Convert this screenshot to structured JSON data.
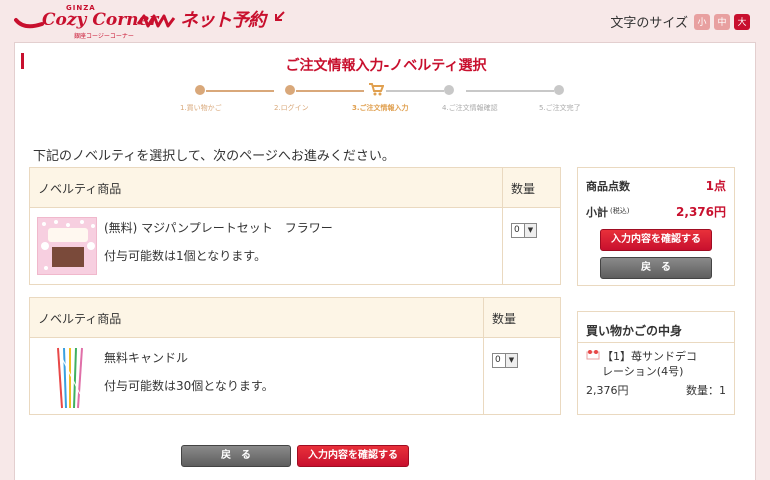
{
  "header": {
    "logo_top": "GINZA",
    "logo_main": "Cozy Corner",
    "logo_sub": "銀座コージーコーナー",
    "service_name": "ネット予約",
    "font_size_label": "文字のサイズ",
    "font_sizes": [
      "小",
      "中",
      "大"
    ]
  },
  "page": {
    "title": "ご注文情報入力-ノベルティ選択",
    "intro": "下記のノベルティを選択して、次のページへお進みください。"
  },
  "steps": [
    {
      "label": "1.買い物かご",
      "state": "done"
    },
    {
      "label": "2.ログイン",
      "state": "done"
    },
    {
      "label": "3.ご注文情報入力",
      "state": "current"
    },
    {
      "label": "4.ご注文情報確認",
      "state": "todo"
    },
    {
      "label": "5.ご注文完了",
      "state": "todo"
    }
  ],
  "novelties": [
    {
      "col_item": "ノベルティ商品",
      "col_qty": "数量",
      "name": "(無料) マジパンプレートセット　フラワー",
      "note": "付与可能数は1個となります。",
      "qty": "0",
      "thumb_icon": "marzipan-plate-image"
    },
    {
      "col_item": "ノベルティ商品",
      "col_qty": "数量",
      "name": "無料キャンドル",
      "note": "付与可能数は30個となります。",
      "qty": "0",
      "thumb_icon": "candle-image"
    }
  ],
  "summary": {
    "count_label": "商品点数",
    "count_value": "1点",
    "subtotal_label": "小計",
    "subtotal_tax": "(税込)",
    "subtotal_value": "2,376円",
    "confirm_label": "入力内容を確認する",
    "back_label": "戻　る"
  },
  "cart": {
    "title": "買い物かごの中身",
    "item_line1": "【1】苺サンドデコ",
    "item_line2": "レーション(4号)",
    "price": "2,376円",
    "qty_text": "数量：1",
    "thumb_icon": "cake-image"
  },
  "bottom": {
    "back_label": "戻　る",
    "confirm_label": "入力内容を確認する"
  },
  "colors": {
    "brand": "#c8102e",
    "background": "#f7e8e8",
    "step_done": "#d9a87a",
    "step_current": "#e0a050",
    "step_todo": "#c8c8c8"
  }
}
